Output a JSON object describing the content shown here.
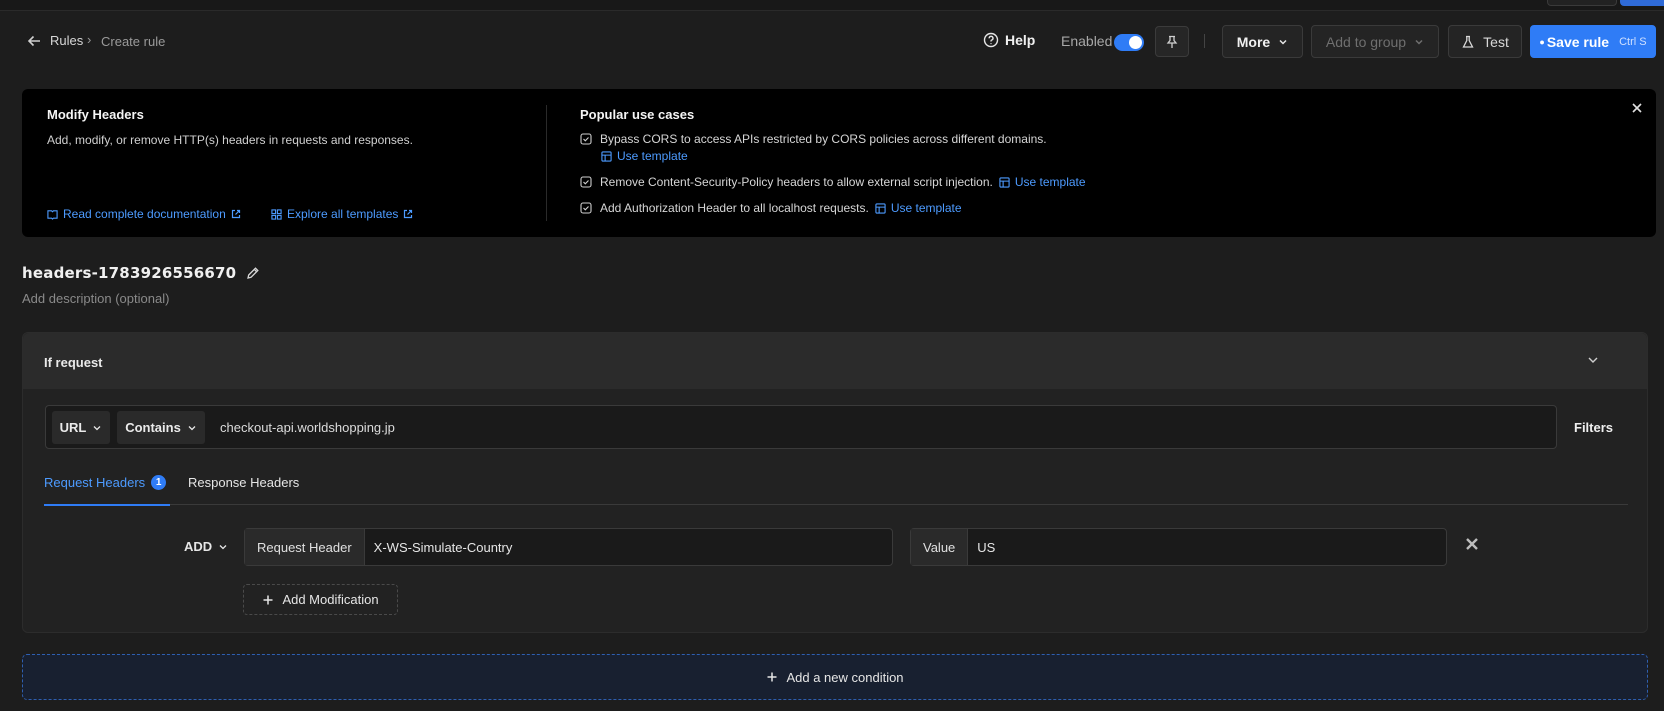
{
  "header": {
    "breadcrumb": {
      "root": "Rules",
      "separator": "›",
      "current": "Create rule"
    },
    "help_label": "Help",
    "enabled_label": "Enabled",
    "enabled": true,
    "more_label": "More",
    "add_to_group_label": "Add to group",
    "test_label": "Test",
    "save_label": "Save rule",
    "save_shortcut": "Ctrl S"
  },
  "banner": {
    "title": "Modify Headers",
    "subtitle": "Add, modify, or remove HTTP(s) headers in requests and responses.",
    "doc_link": "Read complete documentation",
    "templates_link": "Explore all templates",
    "popular_title": "Popular use cases",
    "use_cases": [
      {
        "text": "Bypass CORS to access APIs restricted by CORS policies across different domains.",
        "link": "Use template"
      },
      {
        "text": "Remove Content-Security-Policy headers to allow external script injection.",
        "link": "Use template"
      },
      {
        "text": "Add Authorization Header to all localhost requests.",
        "link": "Use template"
      }
    ]
  },
  "rule": {
    "name": "headers-1783926556670",
    "description_placeholder": "Add description (optional)"
  },
  "condition": {
    "title": "If request",
    "match_field": "URL",
    "operator": "Contains",
    "value": "checkout-api.worldshopping.jp",
    "filters_label": "Filters"
  },
  "tabs": {
    "request_label": "Request Headers",
    "request_count": "1",
    "response_label": "Response Headers"
  },
  "modification": {
    "action": "ADD",
    "header_label": "Request Header",
    "header_value": "X-WS-Simulate-Country",
    "value_label": "Value",
    "value": "US",
    "add_modification_label": "Add Modification"
  },
  "add_condition_label": "Add a new condition",
  "colors": {
    "accent": "#2f7cf6",
    "link": "#4d9bff",
    "background": "#1d1d1d"
  }
}
